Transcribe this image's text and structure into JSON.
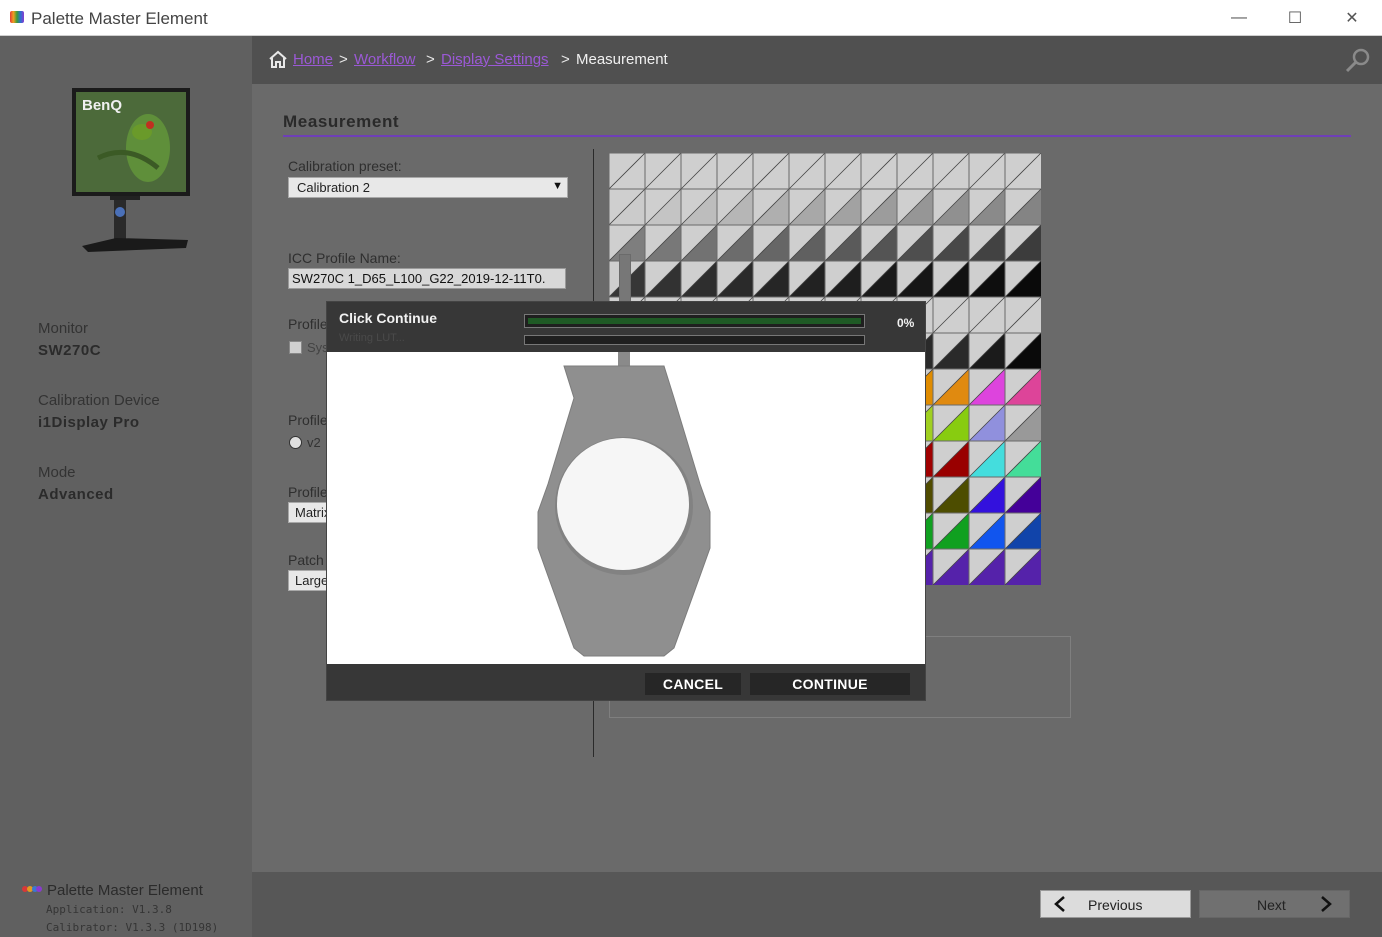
{
  "window": {
    "title": "Palette Master Element",
    "controls": {
      "minimize": "—",
      "maximize": "☐",
      "close": "✕"
    }
  },
  "sidebar": {
    "monitor_label": "Monitor",
    "monitor_value": "SW270C",
    "device_label": "Calibration Device",
    "device_value": "i1Display Pro",
    "mode_label": "Mode",
    "mode_value": "Advanced",
    "product_name": "Palette Master Element",
    "application_version": "Application: V1.3.8",
    "calibrator_version": "Calibrator: V1.3.3 (1D198)",
    "monitor_brand_text": "BenQ"
  },
  "breadcrumb": {
    "home": "Home",
    "workflow": "Workflow",
    "display_settings": "Display Settings",
    "current": "Measurement",
    "separator": ">"
  },
  "page": {
    "section_title": "Measurement",
    "calibration_preset_label": "Calibration preset:",
    "calibration_preset_value": "Calibration 2",
    "icc_profile_label": "ICC Profile Name:",
    "icc_profile_value": "SW270C 1_D65_L100_G22_2019-12-11T0.",
    "profile_label_1": "Profile",
    "checkbox_partial": "Sys",
    "profile_label_2": "Profile",
    "radio_partial": "v2",
    "profile_label_3": "Profile",
    "profile_select_partial": "Matrix",
    "patch_label_partial": "Patch",
    "patch_select_partial": "Large"
  },
  "modal": {
    "title": "Click Continue",
    "status": "Writing LUT...",
    "progress_percent": "0%",
    "progress_value": 0,
    "cancel_label": "CANCEL",
    "continue_label": "CONTINUE"
  },
  "footer": {
    "previous_label": "Previous",
    "next_label": "Next"
  },
  "colors": {
    "accent": "#6f3fb8",
    "link": "#9b59d6",
    "progress_fill": "#1f5a25"
  },
  "patch_grid": {
    "cols": 12,
    "rows": 12,
    "colors": [
      [
        "#cfcfcf",
        "#cfcfcf",
        "#cfcfcf",
        "#cfcfcf",
        "#cfcfcf",
        "#cfcfcf",
        "#cfcfcf",
        "#cfcfcf",
        "#cfcfcf",
        "#cfcfcf",
        "#cfcfcf",
        "#cfcfcf"
      ],
      [
        "#cbcbcb",
        "#c4c4c4",
        "#bdbdbd",
        "#b6b6b6",
        "#afafaf",
        "#a8a8a8",
        "#a2a2a2",
        "#9c9c9c",
        "#969696",
        "#909090",
        "#8a8a8a",
        "#848484"
      ],
      [
        "#7e7e7e",
        "#787878",
        "#727272",
        "#6c6c6c",
        "#666666",
        "#606060",
        "#5a5a5a",
        "#545454",
        "#4e4e4e",
        "#484848",
        "#424242",
        "#3c3c3c"
      ],
      [
        "#363636",
        "#323232",
        "#2e2e2e",
        "#2a2a2a",
        "#262626",
        "#222222",
        "#1e1e1e",
        "#1a1a1a",
        "#161616",
        "#121212",
        "#0e0e0e",
        "#0a0a0a"
      ],
      [
        "#cfcfcf",
        "#cfcfcf",
        "#cfcfcf",
        "#cfcfcf",
        "#cfcfcf",
        "#cfcfcf",
        "#cfcfcf",
        "#cfcfcf",
        "#cfcfcf",
        "#cfcfcf",
        "#cfcfcf",
        "#cfcfcf"
      ],
      [
        "#2a2a2a",
        "#2a2a2a",
        "#2a2a2a",
        "#2a2a2a",
        "#2a2a2a",
        "#2a2a2a",
        "#2a2a2a",
        "#2a2a2a",
        "#2a2a2a",
        "#2a2a2a",
        "#1b1b1b",
        "#0a0a0a"
      ],
      [
        "#c0a080",
        "#c08060",
        "#a06040",
        "#d09060",
        "#c07030",
        "#d07020",
        "#e08020",
        "#e09010",
        "#e08c00",
        "#e08a10",
        "#dd44dd",
        "#dd4499"
      ],
      [
        "#90c040",
        "#80c020",
        "#70c010",
        "#88cc20",
        "#90c010",
        "#99cc00",
        "#99d020",
        "#9acd14",
        "#a0d020",
        "#88cc10",
        "#9090dd",
        "#999999"
      ],
      [
        "#aa2222",
        "#aa2222",
        "#aa1111",
        "#a01010",
        "#aa1515",
        "#aa1010",
        "#a00a0a",
        "#990000",
        "#a00000",
        "#990000",
        "#44dddd",
        "#44dd99"
      ],
      [
        "#555500",
        "#555500",
        "#555500",
        "#505000",
        "#555000",
        "#505000",
        "#4a4a00",
        "#555500",
        "#504c00",
        "#4d4d00",
        "#3311dd",
        "#440099"
      ],
      [
        "#108820",
        "#108820",
        "#108820",
        "#108820",
        "#0a8a1a",
        "#0a8a1a",
        "#109020",
        "#10a020",
        "#10a020",
        "#10a020",
        "#1155ee",
        "#1144aa"
      ],
      [
        "#5522aa",
        "#5522aa",
        "#5522aa",
        "#5522aa",
        "#5522aa",
        "#5522aa",
        "#5522aa",
        "#5522aa",
        "#5522aa",
        "#5522aa",
        "#5522aa",
        "#5522aa"
      ]
    ]
  },
  "icons": {
    "home": "home-icon",
    "search": "search-icon",
    "previous": "chevron-left-icon",
    "next": "chevron-right-icon"
  }
}
